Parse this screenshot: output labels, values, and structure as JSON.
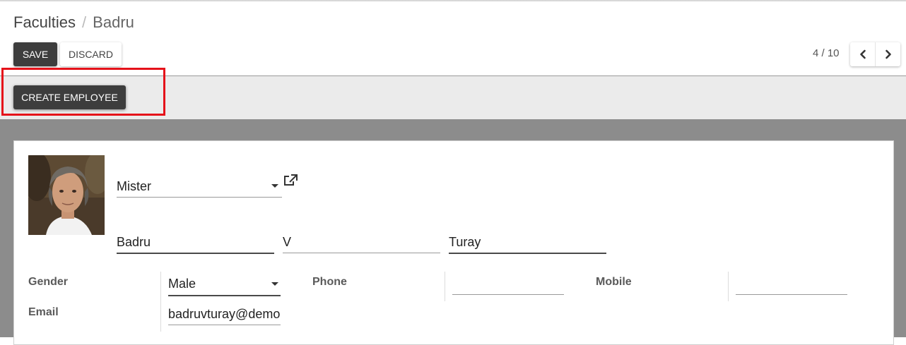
{
  "breadcrumb": {
    "parent": "Faculties",
    "separator": "/",
    "current": "Badru"
  },
  "buttons": {
    "save": "SAVE",
    "discard": "DISCARD",
    "create_employee": "CREATE EMPLOYEE"
  },
  "pager": {
    "value": "4 / 10"
  },
  "form": {
    "title": "Mister",
    "first_name": "Badru",
    "middle_name": "V",
    "last_name": "Turay",
    "gender_label": "Gender",
    "gender": "Male",
    "email_label": "Email",
    "email": "badruvturay@demo",
    "phone_label": "Phone",
    "phone": "",
    "mobile_label": "Mobile",
    "mobile": ""
  },
  "icons": {
    "prev": "chevron-left-icon",
    "next": "chevron-right-icon",
    "external": "external-link-icon",
    "dropdown": "caret-down-icon"
  },
  "colors": {
    "primary_button": "#3d3d3d",
    "highlight": "#e5121a",
    "header_bar": "#ebebeb"
  }
}
